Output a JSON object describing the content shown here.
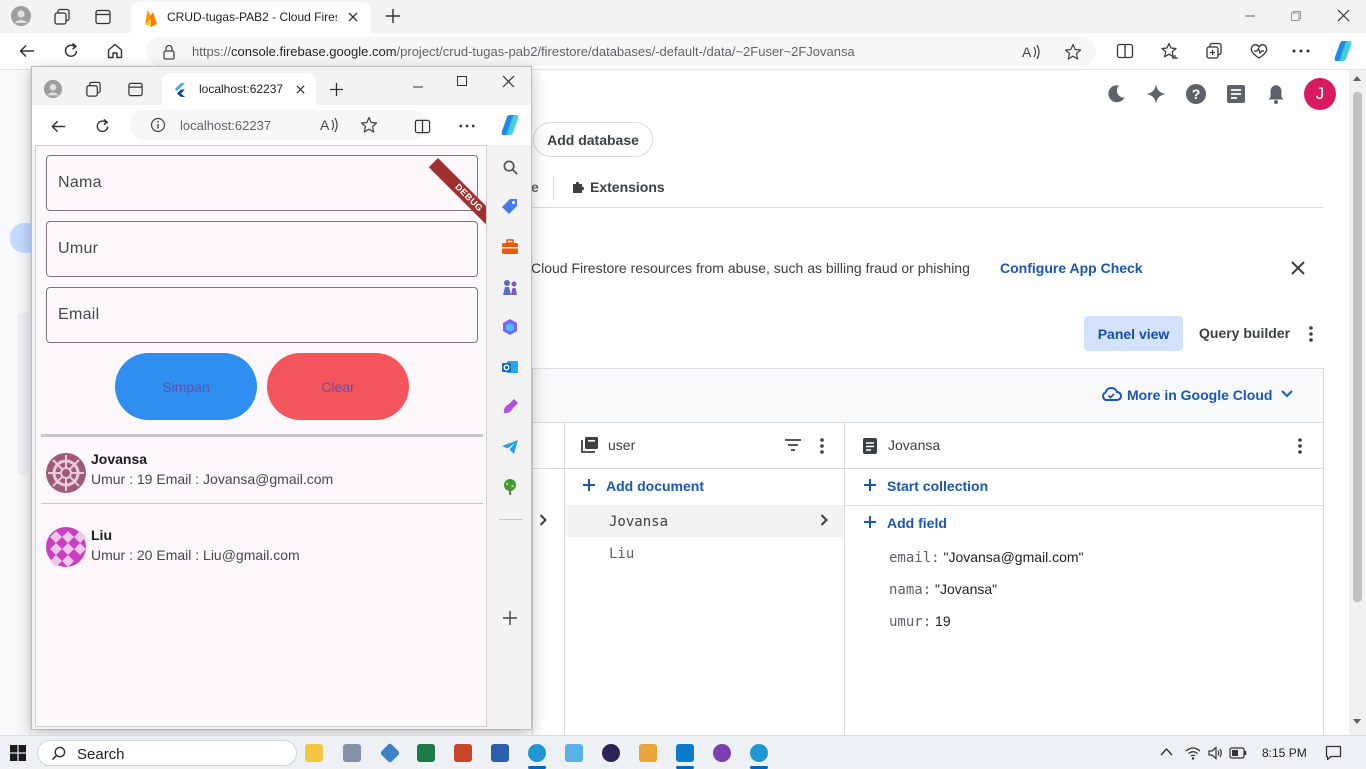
{
  "outer_browser": {
    "tab_title": "CRUD-tugas-PAB2 - Cloud Firestore",
    "url_prefix": "https://",
    "url_host": "console.firebase.google.com",
    "url_path": "/project/crud-tugas-pab2/firestore/databases/-default-/data/~2Fuser~2FJovansa"
  },
  "firebase": {
    "avatar_letter": "J",
    "add_database_label": "Add database",
    "tab_partial": "e",
    "extensions_label": "Extensions",
    "banner_text": "Cloud Firestore resources from abuse, such as billing fraud or phishing",
    "configure_app_check": "Configure App Check",
    "panel_view": "Panel view",
    "query_builder": "Query builder",
    "more_in_google_cloud": "More in Google Cloud",
    "collection_name": "user",
    "add_document": "Add document",
    "documents": [
      "Jovansa",
      "Liu"
    ],
    "document_name": "Jovansa",
    "start_collection": "Start collection",
    "add_field": "Add field",
    "fields": [
      {
        "key": "email:",
        "value": "\"Jovansa@gmail.com\""
      },
      {
        "key": "nama:",
        "value": "\"Jovansa\""
      },
      {
        "key": "umur:",
        "value": "19"
      }
    ]
  },
  "inner_browser": {
    "tab_title": "localhost:62237",
    "url": "localhost:62237",
    "debug_banner": "DEBUG"
  },
  "app": {
    "field_nama": "Nama",
    "field_umur": "Umur",
    "field_email": "Email",
    "btn_simpan": "Simpan",
    "btn_clear": "Clear",
    "users": [
      {
        "name": "Jovansa",
        "sub": "Umur : 19 Email : Jovansa@gmail.com"
      },
      {
        "name": "Liu",
        "sub": "Umur : 20 Email : Liu@gmail.com"
      }
    ],
    "colors": {
      "simpan": "#2f8ff0",
      "clear": "#f4545c",
      "button_text": "#6750a4"
    }
  },
  "taskbar": {
    "search_label": "Search",
    "time": "8:15 PM"
  }
}
